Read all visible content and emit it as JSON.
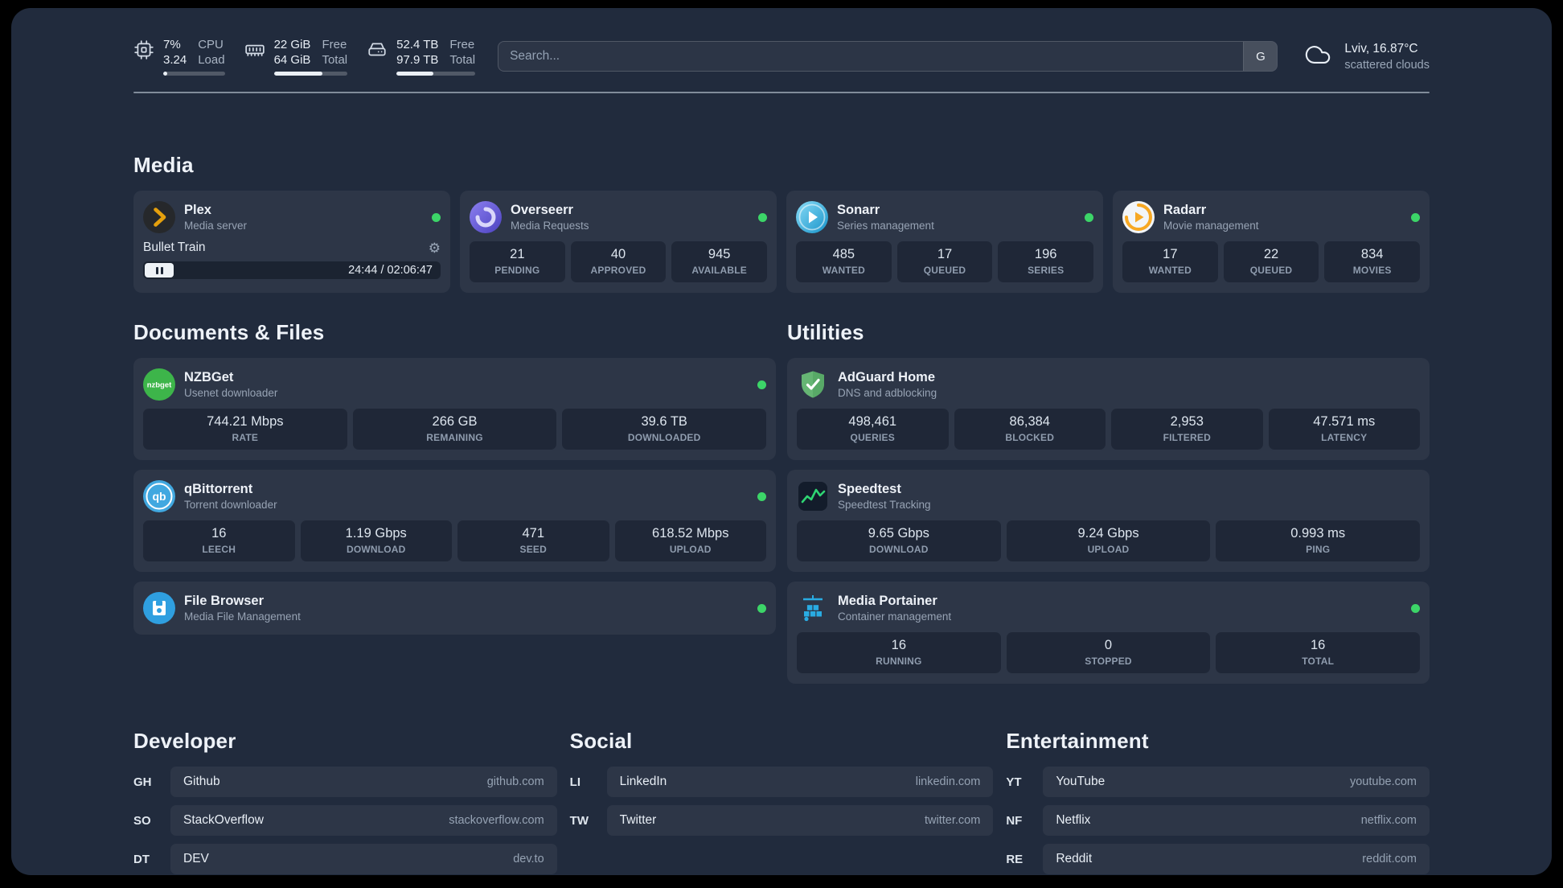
{
  "colors": {
    "status_online": "#3cd568",
    "plex_accent": "#e5a00d"
  },
  "header": {
    "cpu": {
      "line1": "7%",
      "line2": "3.24",
      "label1": "CPU",
      "label2": "Load",
      "bar_percent": 7
    },
    "memory": {
      "line1": "22 GiB",
      "line2": "64 GiB",
      "label1": "Free",
      "label2": "Total",
      "bar_percent": 66
    },
    "disk": {
      "line1": "52.4 TB",
      "line2": "97.9 TB",
      "label1": "Free",
      "label2": "Total",
      "bar_percent": 47
    },
    "search": {
      "placeholder": "Search...",
      "provider_button": "G"
    },
    "weather": {
      "location": "Lviv, 16.87°C",
      "condition": "scattered clouds"
    }
  },
  "sections": {
    "media": {
      "title": "Media",
      "plex": {
        "name": "Plex",
        "desc": "Media server",
        "now_playing": "Bullet Train",
        "time": "24:44 / 02:06:47"
      },
      "overseerr": {
        "name": "Overseerr",
        "desc": "Media Requests",
        "stats": [
          {
            "value": "21",
            "label": "PENDING"
          },
          {
            "value": "40",
            "label": "APPROVED"
          },
          {
            "value": "945",
            "label": "AVAILABLE"
          }
        ]
      },
      "sonarr": {
        "name": "Sonarr",
        "desc": "Series management",
        "stats": [
          {
            "value": "485",
            "label": "WANTED"
          },
          {
            "value": "17",
            "label": "QUEUED"
          },
          {
            "value": "196",
            "label": "SERIES"
          }
        ]
      },
      "radarr": {
        "name": "Radarr",
        "desc": "Movie management",
        "stats": [
          {
            "value": "17",
            "label": "WANTED"
          },
          {
            "value": "22",
            "label": "QUEUED"
          },
          {
            "value": "834",
            "label": "MOVIES"
          }
        ]
      }
    },
    "documents": {
      "title": "Documents & Files",
      "nzbget": {
        "name": "NZBGet",
        "desc": "Usenet downloader",
        "stats": [
          {
            "value": "744.21 Mbps",
            "label": "RATE"
          },
          {
            "value": "266 GB",
            "label": "REMAINING"
          },
          {
            "value": "39.6 TB",
            "label": "DOWNLOADED"
          }
        ]
      },
      "qbittorrent": {
        "name": "qBittorrent",
        "desc": "Torrent downloader",
        "stats": [
          {
            "value": "16",
            "label": "LEECH"
          },
          {
            "value": "1.19 Gbps",
            "label": "DOWNLOAD"
          },
          {
            "value": "471",
            "label": "SEED"
          },
          {
            "value": "618.52 Mbps",
            "label": "UPLOAD"
          }
        ]
      },
      "filebrowser": {
        "name": "File Browser",
        "desc": "Media File Management"
      }
    },
    "utilities": {
      "title": "Utilities",
      "adguard": {
        "name": "AdGuard Home",
        "desc": "DNS and adblocking",
        "stats": [
          {
            "value": "498,461",
            "label": "QUERIES"
          },
          {
            "value": "86,384",
            "label": "BLOCKED"
          },
          {
            "value": "2,953",
            "label": "FILTERED"
          },
          {
            "value": "47.571 ms",
            "label": "LATENCY"
          }
        ]
      },
      "speedtest": {
        "name": "Speedtest",
        "desc": "Speedtest Tracking",
        "stats": [
          {
            "value": "9.65 Gbps",
            "label": "DOWNLOAD"
          },
          {
            "value": "9.24 Gbps",
            "label": "UPLOAD"
          },
          {
            "value": "0.993 ms",
            "label": "PING"
          }
        ]
      },
      "portainer": {
        "name": "Media Portainer",
        "desc": "Container management",
        "stats": [
          {
            "value": "16",
            "label": "RUNNING"
          },
          {
            "value": "0",
            "label": "STOPPED"
          },
          {
            "value": "16",
            "label": "TOTAL"
          }
        ]
      }
    },
    "developer": {
      "title": "Developer",
      "items": [
        {
          "abbr": "GH",
          "name": "Github",
          "url": "github.com"
        },
        {
          "abbr": "SO",
          "name": "StackOverflow",
          "url": "stackoverflow.com"
        },
        {
          "abbr": "DT",
          "name": "DEV",
          "url": "dev.to"
        }
      ]
    },
    "social": {
      "title": "Social",
      "items": [
        {
          "abbr": "LI",
          "name": "LinkedIn",
          "url": "linkedin.com"
        },
        {
          "abbr": "TW",
          "name": "Twitter",
          "url": "twitter.com"
        }
      ]
    },
    "entertainment": {
      "title": "Entertainment",
      "items": [
        {
          "abbr": "YT",
          "name": "YouTube",
          "url": "youtube.com"
        },
        {
          "abbr": "NF",
          "name": "Netflix",
          "url": "netflix.com"
        },
        {
          "abbr": "RE",
          "name": "Reddit",
          "url": "reddit.com"
        }
      ]
    }
  }
}
